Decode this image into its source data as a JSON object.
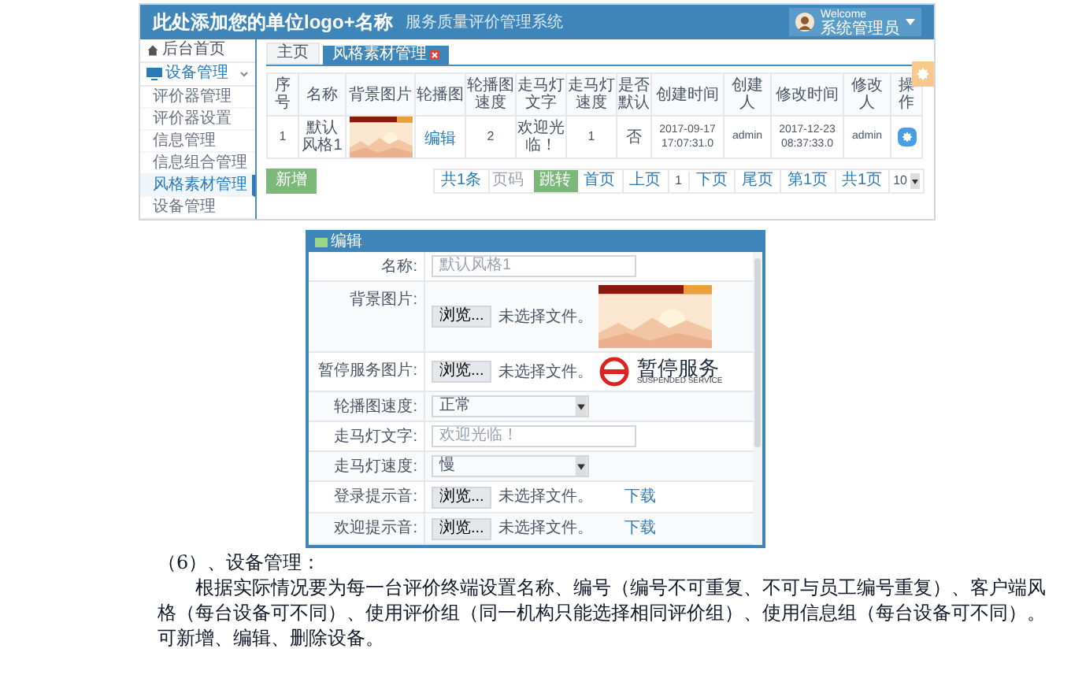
{
  "admin_screenshot": {
    "header": {
      "title": "此处添加您的单位logo+名称",
      "subtitle": "服务质量评价管理系统",
      "welcome": "Welcome",
      "user": "系统管理员"
    },
    "sidebar": {
      "items": [
        {
          "label": "后台首页",
          "kind": "home",
          "selected": false
        },
        {
          "label": "设备管理",
          "kind": "group",
          "selected": false,
          "expanded": true,
          "children": [
            {
              "label": "评价器管理",
              "selected": false
            },
            {
              "label": "评价器设置",
              "selected": false
            },
            {
              "label": "信息管理",
              "selected": false
            },
            {
              "label": "信息组合管理",
              "selected": false
            },
            {
              "label": "风格素材管理",
              "selected": true
            },
            {
              "label": "设备管理",
              "selected": false
            }
          ]
        }
      ]
    },
    "tabs": [
      {
        "label": "主页",
        "selected": false,
        "closable": false
      },
      {
        "label": "风格素材管理",
        "selected": true,
        "closable": true
      }
    ],
    "table": {
      "columns": [
        "序号",
        "名称",
        "背景图片",
        "轮播图",
        "轮播图速度",
        "走马灯文字",
        "走马灯速度",
        "是否默认",
        "创建时间",
        "创建人",
        "修改时间",
        "修改人",
        "操作"
      ],
      "rows": [
        {
          "index": "1",
          "name": "默认风格1",
          "carousel_link": "编辑",
          "carousel_speed": "2",
          "marquee_text": "欢迎光临！",
          "marquee_speed": "1",
          "is_default": "否",
          "created": "2017-09-17 17:07:31.0",
          "creator": "admin",
          "modified": "2017-12-23 08:37:33.0",
          "modifier": "admin"
        }
      ]
    },
    "add_button": "新增",
    "pagination": {
      "total": "共1条",
      "page_placeholder": "页码",
      "jump": "跳转",
      "first": "首页",
      "prev": "上页",
      "current": "1",
      "next": "下页",
      "last": "尾页",
      "page_of": "第1页",
      "pages_total": "共1页",
      "page_size": "10"
    }
  },
  "edit_dialog": {
    "title": "编辑",
    "fields": [
      {
        "label": "名称:",
        "kind": "text",
        "placeholder": "默认风格1"
      },
      {
        "label": "背景图片:",
        "button": "浏览...",
        "file_status": "未选择文件。"
      },
      {
        "label": "暂停服务图片:",
        "button": "浏览...",
        "file_status": "未选择文件。",
        "logo_text": "暂停服务",
        "logo_subtext": "SUSPENDED SERVICE"
      },
      {
        "label": "轮播图速度:",
        "kind": "select",
        "value": "正常"
      },
      {
        "label": "走马灯文字:",
        "kind": "text",
        "placeholder": "欢迎光临！"
      },
      {
        "label": "走马灯速度:",
        "kind": "select",
        "value": "慢"
      },
      {
        "label": "登录提示音:",
        "kind": "audio",
        "button": "浏览...",
        "file_status": "未选择文件。",
        "link": "下载"
      },
      {
        "label": "欢迎提示音:",
        "kind": "audio",
        "button": "浏览...",
        "file_status": "未选择文件。",
        "link": "下载"
      }
    ]
  },
  "document": {
    "heading": "（6）、设备管理：",
    "paragraph": "根据实际情况要为每一台评价终端设置名称、编号（编号不可重复、不可与员工编号重复）、客户端风格（每台设备可不同）、使用评价组（同一机构只能选择相同评价组）、使用信息组（每台设备可不同）。可新增、编辑、删除设备。"
  }
}
